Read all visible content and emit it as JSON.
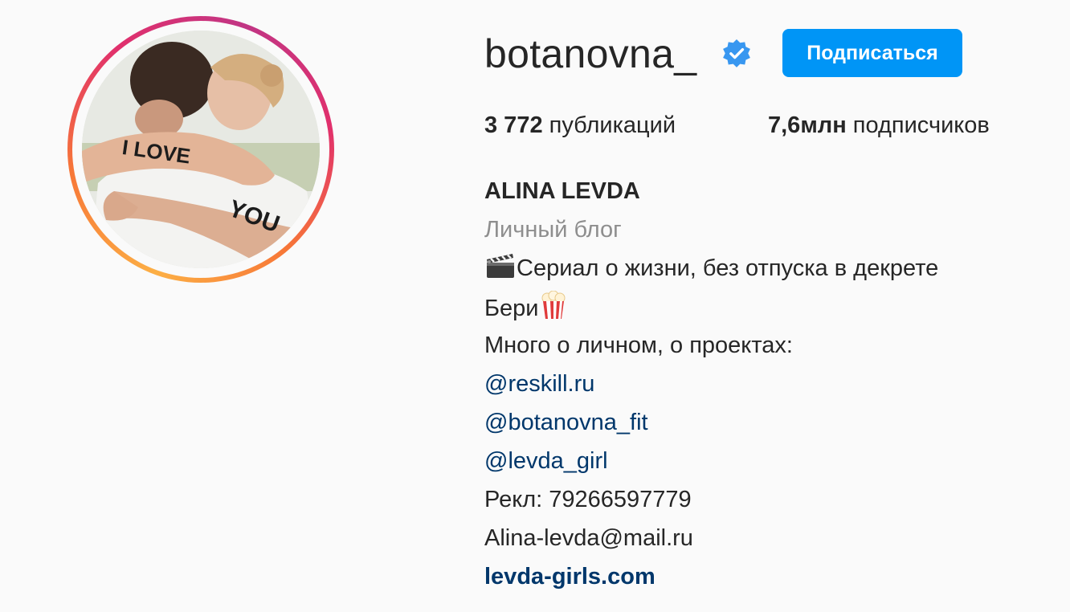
{
  "profile": {
    "username": "botanovna_",
    "verified": true,
    "follow_button": "Подписаться",
    "stats": {
      "posts_count": "3 772",
      "posts_label": "публикаций",
      "followers_count": "7,6млн",
      "followers_label": "подписчиков"
    },
    "bio": {
      "full_name": "ALINA LEVDA",
      "category": "Личный блог",
      "line1": "Сериал о жизни, без отпуска в декрете",
      "line1_emoji": "clapperboard-icon",
      "line2": "Бери",
      "line2_emoji": "popcorn-icon",
      "line3": "Много о личном, о проектах:",
      "mentions": [
        "@reskill.ru",
        "@botanovna_fit",
        "@levda_girl"
      ],
      "ads": "Рекл: 79266597779",
      "email": "Alina-levda@mail.ru",
      "website": "levda-girls.com"
    },
    "avatar_text": [
      "I LOVE",
      "YOU"
    ]
  },
  "colors": {
    "accent": "#0095f6",
    "link": "#00376b",
    "muted": "#8e8e8e",
    "text": "#262626",
    "background": "#fafafa"
  }
}
